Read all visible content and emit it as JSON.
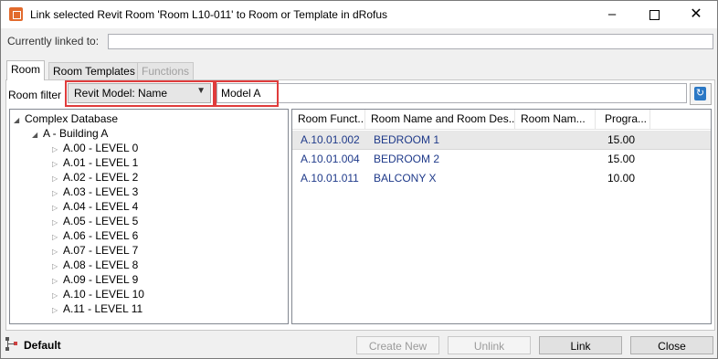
{
  "window": {
    "title": "Link selected Revit Room 'Room L10-011' to Room or Template in dRofus",
    "controls": {
      "minimize": "–",
      "maximize": "□",
      "close": "✕"
    }
  },
  "currently_linked": {
    "label": "Currently linked to:",
    "value": ""
  },
  "tabs": [
    {
      "label": "Room",
      "state": "active"
    },
    {
      "label": "Room Templates",
      "state": "normal"
    },
    {
      "label": "Functions",
      "state": "disabled"
    }
  ],
  "filter": {
    "label": "Room filter",
    "select_value": "Revit Model: Name",
    "input_value": "Model A",
    "highlight_color": "#e03c3c"
  },
  "tree": {
    "root": "Complex Database",
    "building": "A - Building A",
    "levels": [
      "A.00 - LEVEL 0",
      "A.01 - LEVEL 1",
      "A.02 - LEVEL 2",
      "A.03 - LEVEL 3",
      "A.04 - LEVEL 4",
      "A.05 - LEVEL 5",
      "A.06 - LEVEL 6",
      "A.07 - LEVEL 7",
      "A.08 - LEVEL 8",
      "A.09 - LEVEL 9",
      "A.10 - LEVEL 10",
      "A.11 - LEVEL 11"
    ]
  },
  "grid": {
    "columns": [
      "Room Funct...",
      "Room Name and Room Des...",
      "Room Nam...",
      "Progra..."
    ],
    "rows": [
      [
        "A.10.01.002",
        "BEDROOM 1",
        "",
        "15.00"
      ],
      [
        "A.10.01.004",
        "BEDROOM 2",
        "",
        "15.00"
      ],
      [
        "A.10.01.011",
        "BALCONY X",
        "",
        "10.00"
      ]
    ],
    "selected_row": 0
  },
  "footer": {
    "default_label": "Default",
    "buttons": {
      "create_new": "Create New",
      "unlink": "Unlink",
      "link": "Link",
      "close": "Close"
    }
  }
}
